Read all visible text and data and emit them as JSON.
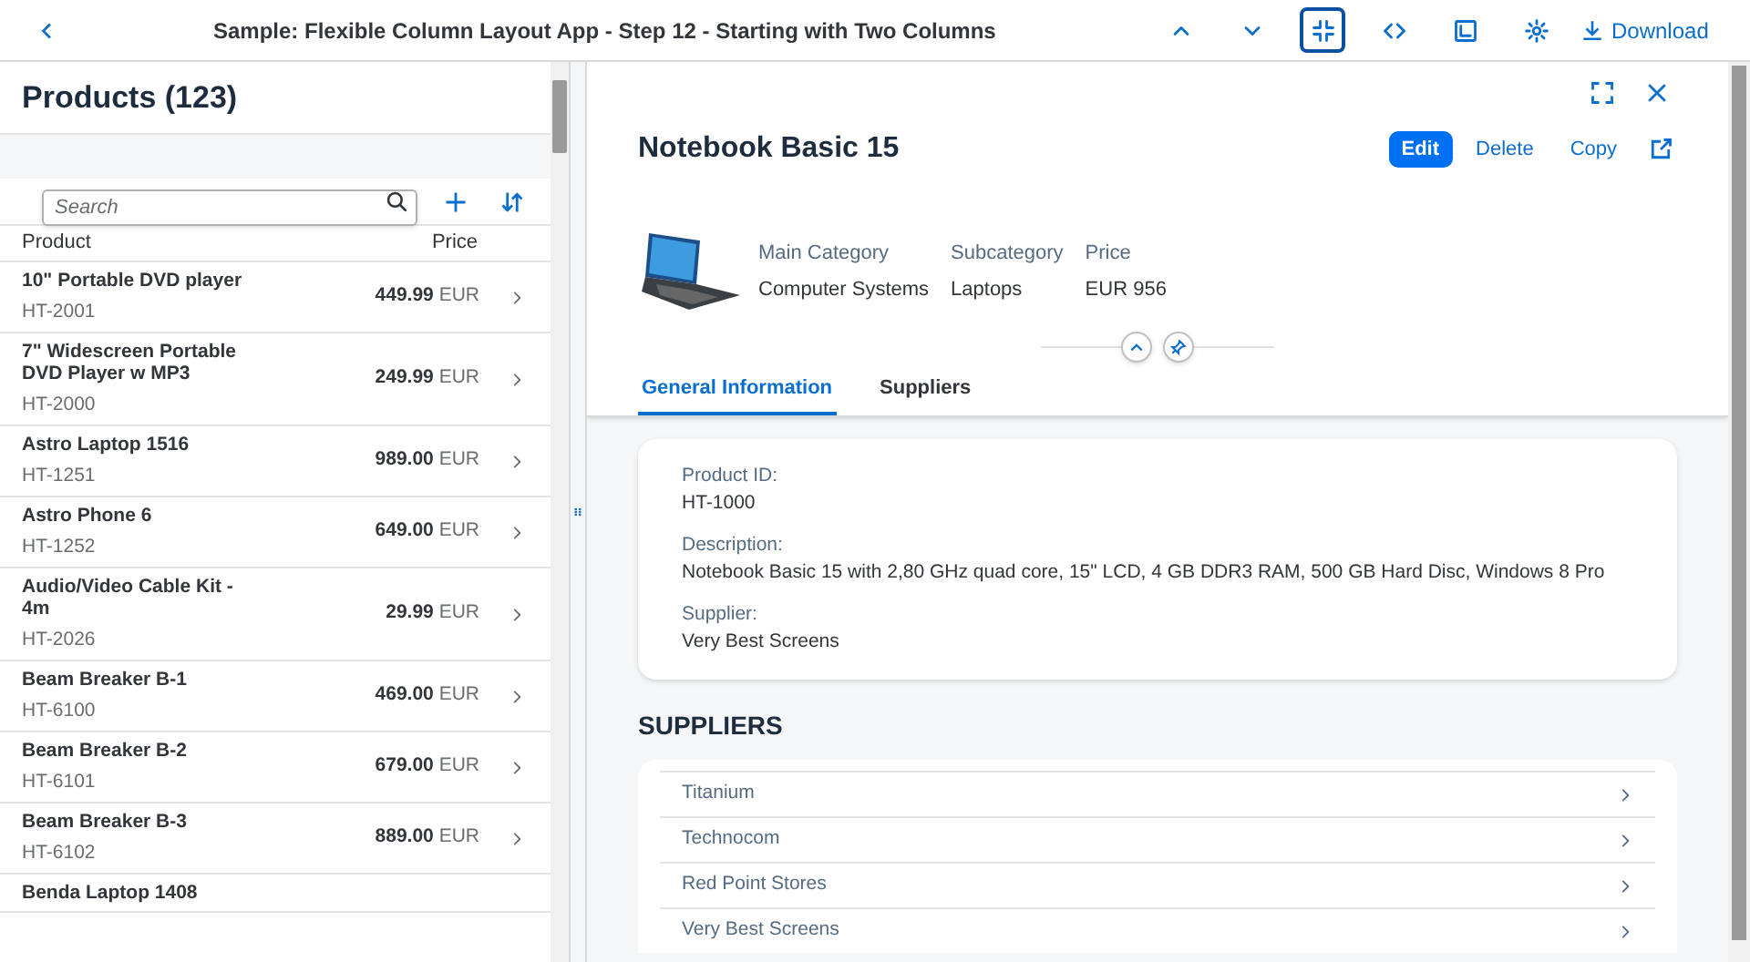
{
  "shell": {
    "title": "Sample: Flexible Column Layout App - Step 12 - Starting with Two Columns",
    "tools": [
      {
        "kind": "up",
        "selected": false
      },
      {
        "kind": "down",
        "selected": false
      },
      {
        "kind": "exit-fullscreen",
        "selected": true
      },
      {
        "kind": "code",
        "selected": false
      },
      {
        "kind": "open-sample",
        "selected": false
      },
      {
        "kind": "settings",
        "selected": false
      }
    ],
    "download": "Download"
  },
  "list": {
    "title": "Products (123)",
    "search": {
      "placeholder": "Search"
    },
    "columns": [
      "Product",
      "Price"
    ],
    "rows": [
      {
        "name": "10\" Portable DVD player",
        "id": "HT-2001",
        "amount": "449.99",
        "currency": "EUR"
      },
      {
        "name": "7\" Widescreen Portable DVD Player w MP3",
        "id": "HT-2000",
        "amount": "249.99",
        "currency": "EUR"
      },
      {
        "name": "Astro Laptop 1516",
        "id": "HT-1251",
        "amount": "989.00",
        "currency": "EUR"
      },
      {
        "name": "Astro Phone 6",
        "id": "HT-1252",
        "amount": "649.00",
        "currency": "EUR"
      },
      {
        "name": "Audio/Video Cable Kit - 4m",
        "id": "HT-2026",
        "amount": "29.99",
        "currency": "EUR"
      },
      {
        "name": "Beam Breaker B-1",
        "id": "HT-6100",
        "amount": "469.00",
        "currency": "EUR"
      },
      {
        "name": "Beam Breaker B-2",
        "id": "HT-6101",
        "amount": "679.00",
        "currency": "EUR"
      },
      {
        "name": "Beam Breaker B-3",
        "id": "HT-6102",
        "amount": "889.00",
        "currency": "EUR"
      },
      {
        "name": "Benda Laptop 1408"
      }
    ]
  },
  "detail": {
    "title": "Notebook Basic 15",
    "actions": [
      {
        "label": "Edit",
        "kind": "emphasized"
      },
      {
        "label": "Delete",
        "kind": "transparent"
      },
      {
        "label": "Copy",
        "kind": "transparent"
      }
    ],
    "attributes": [
      {
        "label": "Main Category",
        "value": "Computer Systems"
      },
      {
        "label": "Subcategory",
        "value": "Laptops"
      },
      {
        "label": "Price",
        "value": "EUR 956"
      }
    ],
    "tabs": [
      {
        "label": "General Information",
        "selected": true
      },
      {
        "label": "Suppliers",
        "selected": false
      }
    ],
    "fields": [
      {
        "label": "Product ID:",
        "value": "HT-1000"
      },
      {
        "label": "Description:",
        "value": "Notebook Basic 15 with 2,80 GHz quad core, 15\" LCD, 4 GB DDR3 RAM, 500 GB Hard Disc, Windows 8 Pro"
      },
      {
        "label": "Supplier:",
        "value": "Very Best Screens"
      }
    ],
    "suppliers_title": "SUPPLIERS",
    "suppliers": [
      "Titanium",
      "Technocom",
      "Red Point Stores",
      "Very Best Screens"
    ]
  }
}
